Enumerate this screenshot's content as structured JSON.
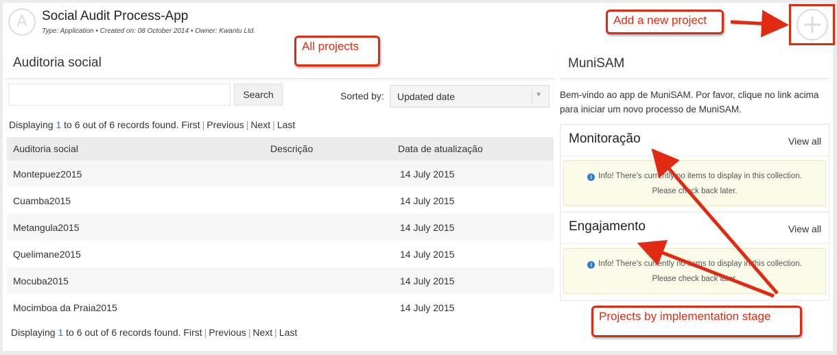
{
  "header": {
    "logo_glyph": "A",
    "title": "Social Audit Process-App",
    "meta": "Type: Application • Created on: 08 October 2014 • Owner: Kwantu Ltd.",
    "add_glyph": "+"
  },
  "left_panel": {
    "title": "Auditoria social",
    "search": {
      "placeholder": "",
      "button_label": "Search"
    },
    "sort": {
      "label": "Sorted by:",
      "value": "Updated date"
    },
    "pager": {
      "prefix": "Displaying",
      "from": "1",
      "middle": "to 6 out of 6 records found.",
      "first": "First",
      "previous": "Previous",
      "next": "Next",
      "last": "Last"
    },
    "columns": [
      "Auditoria social",
      "Descrição",
      "Data de atualização"
    ],
    "rows": [
      {
        "name": "Montepuez2015",
        "description": "",
        "date": "14 July 2015"
      },
      {
        "name": "Cuamba2015",
        "description": "",
        "date": "14 July 2015"
      },
      {
        "name": "Metangula2015",
        "description": "",
        "date": "14 July 2015"
      },
      {
        "name": "Quelimane2015",
        "description": "",
        "date": "14 July 2015"
      },
      {
        "name": "Mocuba2015",
        "description": "",
        "date": "14 July 2015"
      },
      {
        "name": "Mocimboa da Praia2015",
        "description": "",
        "date": "14 July 2015"
      }
    ]
  },
  "right_panel": {
    "title": "MuniSAM",
    "welcome": "Bem-vindo ao app de MuniSAM. Por favor, clique no link acima para iniciar um novo processo de MuniSAM.",
    "cards": [
      {
        "title": "Monitoração",
        "view_all": "View all",
        "info_line1": "Info! There's currently no items to display in this collection.",
        "info_line2": "Please check back later."
      },
      {
        "title": "Engajamento",
        "view_all": "View all",
        "info_line1": "Info! There's currently no items to display in this collection.",
        "info_line2": "Please check back later."
      }
    ]
  },
  "annotations": {
    "all_projects": "All projects",
    "add_new_project": "Add a new project",
    "implementation_stage": "Projects by implementation stage",
    "color": "#e02a12"
  }
}
